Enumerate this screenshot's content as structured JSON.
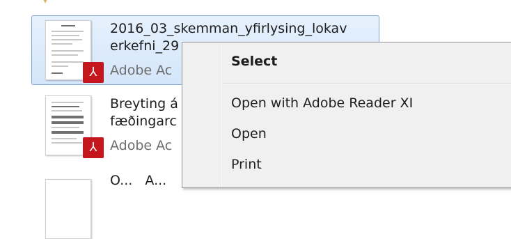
{
  "files": [
    {
      "name_line1": "2016_03_skemman_yfirlysing_lokav",
      "name_line2": "erkefni_29",
      "type": "Adobe Ac",
      "selected": true
    },
    {
      "name_line1": "Breyting á",
      "name_line2": "fæðingarc",
      "type": "Adobe Ac",
      "selected": false
    },
    {
      "name_line1": "O...   A...",
      "name_line2": "",
      "type": "",
      "selected": false
    }
  ],
  "icons": {
    "pdf_badge": "adobe-pdf-icon",
    "pdf_badge_glyph": "⅄"
  },
  "context_menu": {
    "items": [
      {
        "label": "Select",
        "bold": true
      },
      {
        "label": "Open with Adobe Reader XI",
        "bold": false
      },
      {
        "label": "Open",
        "bold": false
      },
      {
        "label": "Print",
        "bold": false
      }
    ]
  },
  "colors": {
    "selection_bg": "#dbeafc",
    "selection_border": "#7da2ce",
    "pdf_red": "#c4161c",
    "menu_bg": "#f0f0f0"
  }
}
